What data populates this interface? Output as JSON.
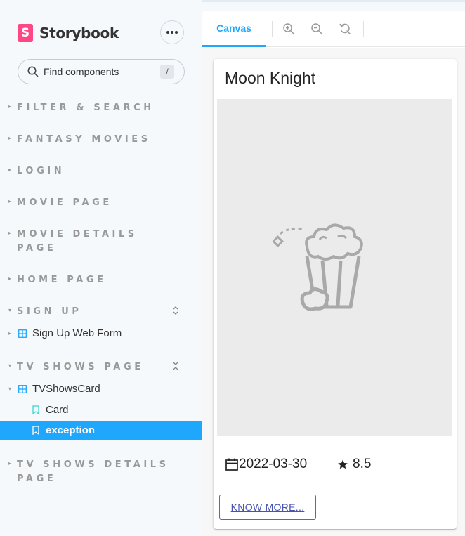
{
  "app": {
    "logo_letter": "S",
    "name": "Storybook",
    "search_placeholder": "Find components",
    "search_shortcut": "/"
  },
  "sidebar": {
    "groups": [
      {
        "label": "FILTER & SEARCH"
      },
      {
        "label": "FANTASY MOVIES"
      },
      {
        "label": "LOGIN"
      },
      {
        "label": "MOVIE PAGE"
      },
      {
        "label": "MOVIE DETAILS",
        "label2": "PAGE"
      },
      {
        "label": "HOME PAGE"
      },
      {
        "label": "SIGN UP"
      },
      {
        "label": "TV SHOWS PAGE"
      },
      {
        "label": "TV SHOWS DETAILS",
        "label2": "PAGE"
      }
    ],
    "components": {
      "sign_up_web_form": "Sign Up Web Form",
      "tv_shows_card": "TVShowsCard"
    },
    "stories": {
      "card": "Card",
      "exception": "exception"
    },
    "selected_color": "#1ea7fd"
  },
  "toolbar": {
    "canvas_tab": "Canvas",
    "icons": [
      "zoom-in-icon",
      "zoom-out-icon",
      "reset-zoom-icon"
    ]
  },
  "card": {
    "title": "Moon Knight",
    "date": "2022-03-30",
    "rating": "8.5",
    "button_label": "KNOW MORE..."
  },
  "colors": {
    "accent": "#1ea7fd",
    "brand": "#ff4785",
    "button_text": "#4653b3"
  }
}
